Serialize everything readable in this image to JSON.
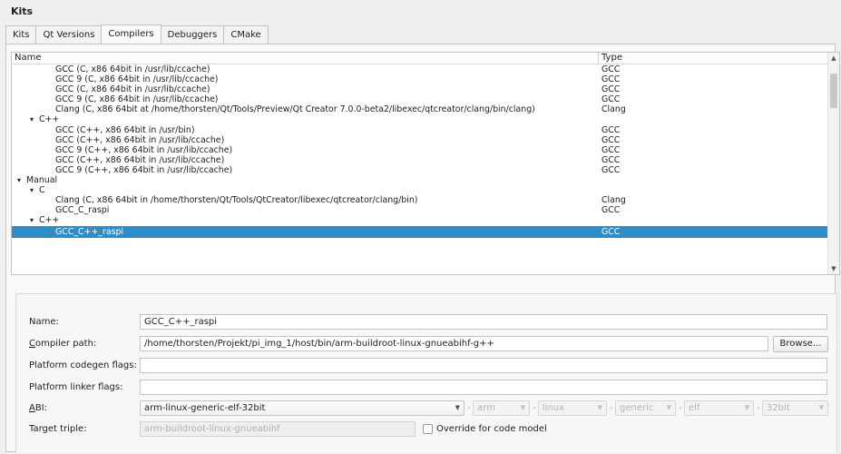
{
  "header": {
    "title": "Kits"
  },
  "tabs": [
    {
      "label": "Kits"
    },
    {
      "label": "Qt Versions"
    },
    {
      "label": "Compilers"
    },
    {
      "label": "Debuggers"
    },
    {
      "label": "CMake"
    }
  ],
  "tree": {
    "columns": {
      "name": "Name",
      "type": "Type"
    },
    "rows": [
      {
        "name": "GCC (C, x86 64bit in /usr/lib/ccache)",
        "type": "GCC",
        "level": 2
      },
      {
        "name": "GCC 9 (C, x86 64bit in /usr/lib/ccache)",
        "type": "GCC",
        "level": 2
      },
      {
        "name": "GCC (C, x86 64bit in /usr/lib/ccache)",
        "type": "GCC",
        "level": 2
      },
      {
        "name": "GCC 9 (C, x86 64bit in /usr/lib/ccache)",
        "type": "GCC",
        "level": 2
      },
      {
        "name": "Clang (C, x86 64bit at /home/thorsten/Qt/Tools/Preview/Qt Creator 7.0.0-beta2/libexec/qtcreator/clang/bin/clang)",
        "type": "Clang",
        "level": 2
      },
      {
        "name": "C++",
        "type": "",
        "level": 1,
        "expandable": true
      },
      {
        "name": "GCC (C++, x86 64bit in /usr/bin)",
        "type": "GCC",
        "level": 2
      },
      {
        "name": "GCC (C++, x86 64bit in /usr/lib/ccache)",
        "type": "GCC",
        "level": 2
      },
      {
        "name": "GCC 9 (C++, x86 64bit in /usr/lib/ccache)",
        "type": "GCC",
        "level": 2
      },
      {
        "name": "GCC (C++, x86 64bit in /usr/lib/ccache)",
        "type": "GCC",
        "level": 2
      },
      {
        "name": "GCC 9 (C++, x86 64bit in /usr/lib/ccache)",
        "type": "GCC",
        "level": 2
      },
      {
        "name": "Manual",
        "type": "",
        "level": 0,
        "expandable": true
      },
      {
        "name": "C",
        "type": "",
        "level": 1,
        "expandable": true
      },
      {
        "name": "Clang (C, x86 64bit in /home/thorsten/Qt/Tools/QtCreator/libexec/qtcreator/clang/bin)",
        "type": "Clang",
        "level": 2
      },
      {
        "name": "GCC_C_raspi",
        "type": "GCC",
        "level": 2
      },
      {
        "name": "C++",
        "type": "",
        "level": 1,
        "expandable": true
      },
      {
        "name": "GCC_C++_raspi",
        "type": "GCC",
        "level": 2,
        "selected": true
      }
    ],
    "scroll_position": 0.06
  },
  "form": {
    "name_label": "Name:",
    "name_value": "GCC_C++_raspi",
    "compiler_path_label_u": "C",
    "compiler_path_label_rest": "ompiler path:",
    "compiler_path_value": "/home/thorsten/Projekt/pi_img_1/host/bin/arm-buildroot-linux-gnueabihf-g++",
    "browse_label": "Browse...",
    "codegen_flags_label": "Platform codegen flags:",
    "codegen_flags_value": "",
    "linker_flags_label": "Platform linker flags:",
    "linker_flags_value": "",
    "abi_label_u": "A",
    "abi_label_rest": "BI:",
    "abi_value": "arm-linux-generic-elf-32bit",
    "abi_parts": [
      "arm",
      "linux",
      "generic",
      "elf",
      "32bit"
    ],
    "target_triple_label": "Target triple:",
    "target_triple_value": "arm-buildroot-linux-gnueabihf",
    "override_label": "Override for code model"
  },
  "colors": {
    "selection": "#308cc6",
    "window": "#efefef"
  }
}
